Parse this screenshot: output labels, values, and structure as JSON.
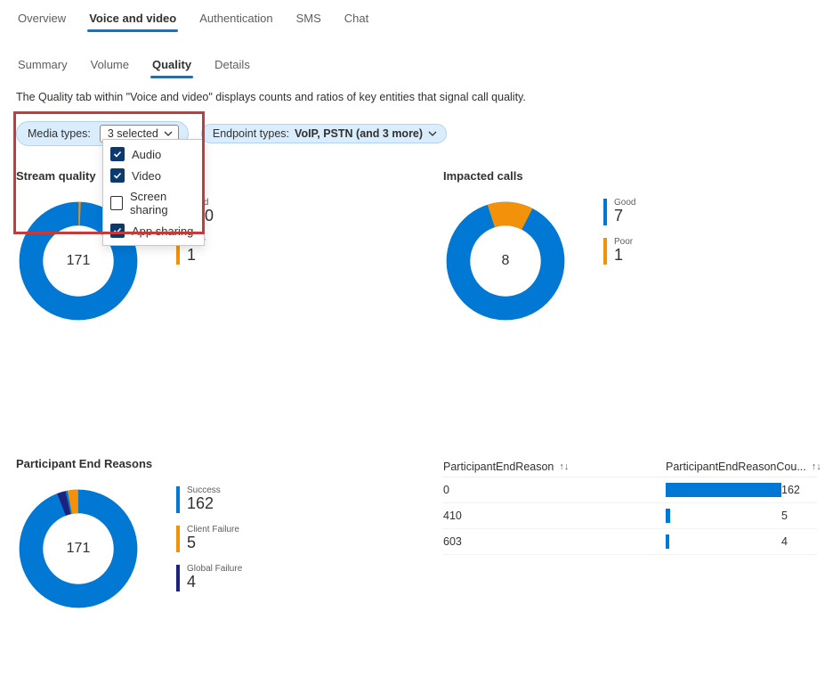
{
  "tabs": {
    "items": [
      "Overview",
      "Voice and video",
      "Authentication",
      "SMS",
      "Chat"
    ],
    "active": 1
  },
  "subtabs": {
    "items": [
      "Summary",
      "Volume",
      "Quality",
      "Details"
    ],
    "active": 2
  },
  "description": "The Quality tab within \"Voice and video\" displays counts and ratios of key entities that signal call quality.",
  "filters": {
    "media": {
      "label": "Media types:",
      "summary": "3 selected",
      "options": [
        {
          "label": "Audio",
          "checked": true
        },
        {
          "label": "Video",
          "checked": true
        },
        {
          "label": "Screen sharing",
          "checked": false
        },
        {
          "label": "App sharing",
          "checked": true
        }
      ]
    },
    "endpoint": {
      "label": "Endpoint types:",
      "value": "VoIP, PSTN (and 3 more)"
    }
  },
  "sections": {
    "stream": {
      "title": "Stream quality",
      "center": "171",
      "legend": [
        {
          "label": "Good",
          "value": "170",
          "color": "#0078d4"
        },
        {
          "label": "Poor",
          "value": "1",
          "color": "#f2910a"
        }
      ]
    },
    "impacted": {
      "title": "Impacted calls",
      "center": "8",
      "legend": [
        {
          "label": "Good",
          "value": "7",
          "color": "#0078d4"
        },
        {
          "label": "Poor",
          "value": "1",
          "color": "#f2910a"
        }
      ]
    },
    "reasons": {
      "title": "Participant End Reasons",
      "center": "171",
      "legend": [
        {
          "label": "Success",
          "value": "162",
          "color": "#0078d4"
        },
        {
          "label": "Client Failure",
          "value": "5",
          "color": "#f2910a"
        },
        {
          "label": "Global Failure",
          "value": "4",
          "color": "#1a237e"
        }
      ]
    },
    "table": {
      "headers": [
        "ParticipantEndReason",
        "ParticipantEndReasonCou..."
      ],
      "rows": [
        {
          "reason": "0",
          "count": 162,
          "pct": 100
        },
        {
          "reason": "410",
          "count": 5,
          "pct": 3.5
        },
        {
          "reason": "603",
          "count": 4,
          "pct": 3
        }
      ]
    }
  },
  "chart_data": [
    {
      "type": "pie",
      "title": "Stream quality",
      "categories": [
        "Good",
        "Poor"
      ],
      "values": [
        170,
        1
      ],
      "total": 171
    },
    {
      "type": "pie",
      "title": "Impacted calls",
      "categories": [
        "Good",
        "Poor"
      ],
      "values": [
        7,
        1
      ],
      "total": 8
    },
    {
      "type": "pie",
      "title": "Participant End Reasons",
      "categories": [
        "Success",
        "Client Failure",
        "Global Failure"
      ],
      "values": [
        162,
        5,
        4
      ],
      "total": 171
    },
    {
      "type": "bar",
      "title": "ParticipantEndReasonCount",
      "categories": [
        "0",
        "410",
        "603"
      ],
      "values": [
        162,
        5,
        4
      ]
    }
  ]
}
